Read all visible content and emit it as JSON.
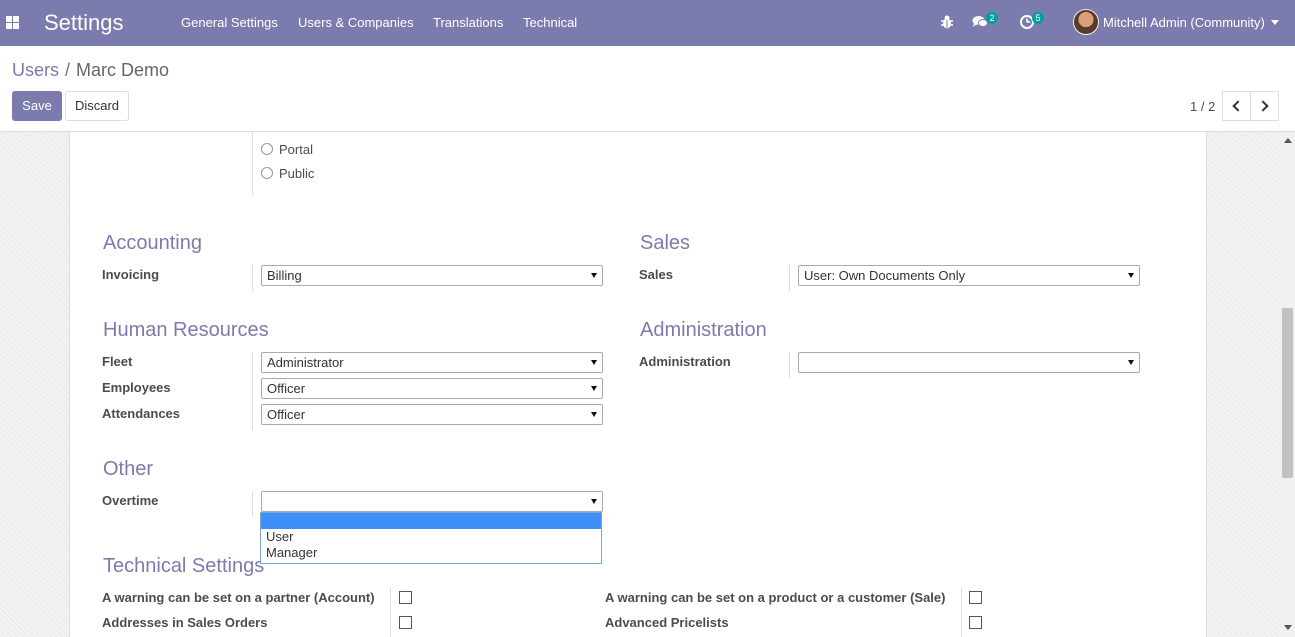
{
  "navbar": {
    "brand": "Settings",
    "menu": [
      "General Settings",
      "Users & Companies",
      "Translations",
      "Technical"
    ],
    "messages_count": "2",
    "activities_count": "5",
    "user_name": "Mitchell Admin (Community)"
  },
  "breadcrumb": {
    "parent": "Users",
    "separator": "/",
    "current": "Marc Demo"
  },
  "buttons": {
    "save": "Save",
    "discard": "Discard"
  },
  "pager": {
    "value": "1 / 2"
  },
  "user_types": [
    "Portal",
    "Public"
  ],
  "groups": {
    "accounting": {
      "title": "Accounting",
      "fields": [
        {
          "label": "Invoicing",
          "value": "Billing"
        }
      ]
    },
    "sales": {
      "title": "Sales",
      "fields": [
        {
          "label": "Sales",
          "value": "User: Own Documents Only"
        }
      ]
    },
    "human_resources": {
      "title": "Human Resources",
      "fields": [
        {
          "label": "Fleet",
          "value": "Administrator"
        },
        {
          "label": "Employees",
          "value": "Officer"
        },
        {
          "label": "Attendances",
          "value": "Officer"
        }
      ]
    },
    "administration": {
      "title": "Administration",
      "fields": [
        {
          "label": "Administration",
          "value": ""
        }
      ]
    },
    "other": {
      "title": "Other",
      "fields": [
        {
          "label": "Overtime",
          "value": ""
        }
      ]
    }
  },
  "overtime_dropdown": {
    "options": [
      "",
      "User",
      "Manager"
    ]
  },
  "technical_settings": {
    "title": "Technical Settings",
    "left": [
      "A warning can be set on a partner (Account)",
      "Addresses in Sales Orders"
    ],
    "right": [
      "A warning can be set on a product or a customer (Sale)",
      "Advanced Pricelists"
    ]
  },
  "colors": {
    "brand": "#7c7bad",
    "badge": "#00a09d",
    "highlight": "#3f8ff8"
  }
}
